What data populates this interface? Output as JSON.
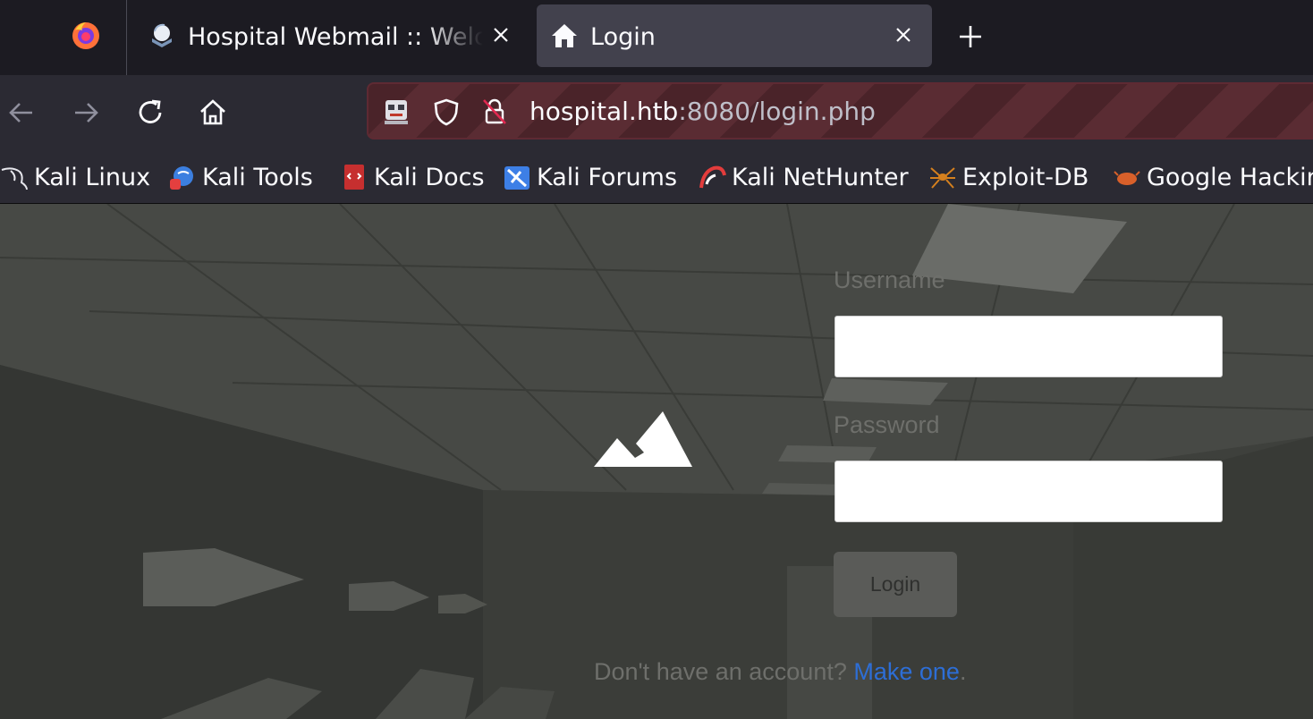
{
  "tabs": [
    {
      "title": "Hospital Webmail :: Welcome",
      "favicon": "roundcube-icon",
      "active": false
    },
    {
      "title": "Login",
      "favicon": "home-icon",
      "active": true
    }
  ],
  "address_bar": {
    "host": "hospital.htb",
    "rest": ":8080/login.php"
  },
  "bookmarks": [
    {
      "label": "Kali Linux",
      "icon": "kali-dragon-icon"
    },
    {
      "label": "Kali Tools",
      "icon": "kali-tools-icon"
    },
    {
      "label": "Kali Docs",
      "icon": "kali-docs-icon"
    },
    {
      "label": "Kali Forums",
      "icon": "kali-forums-icon"
    },
    {
      "label": "Kali NetHunter",
      "icon": "kali-nethunter-icon"
    },
    {
      "label": "Exploit-DB",
      "icon": "exploit-db-icon"
    },
    {
      "label": "Google Hackin",
      "icon": "google-hacking-icon"
    }
  ],
  "login_form": {
    "username_label": "Username",
    "password_label": "Password",
    "username_value": "",
    "password_value": "",
    "submit_label": "Login",
    "signup_prompt": "Don't have an account? ",
    "signup_link": "Make one",
    "signup_suffix": "."
  },
  "colors": {
    "link": "#2d6ed6",
    "private_url_stripe": "#5a2c33"
  }
}
